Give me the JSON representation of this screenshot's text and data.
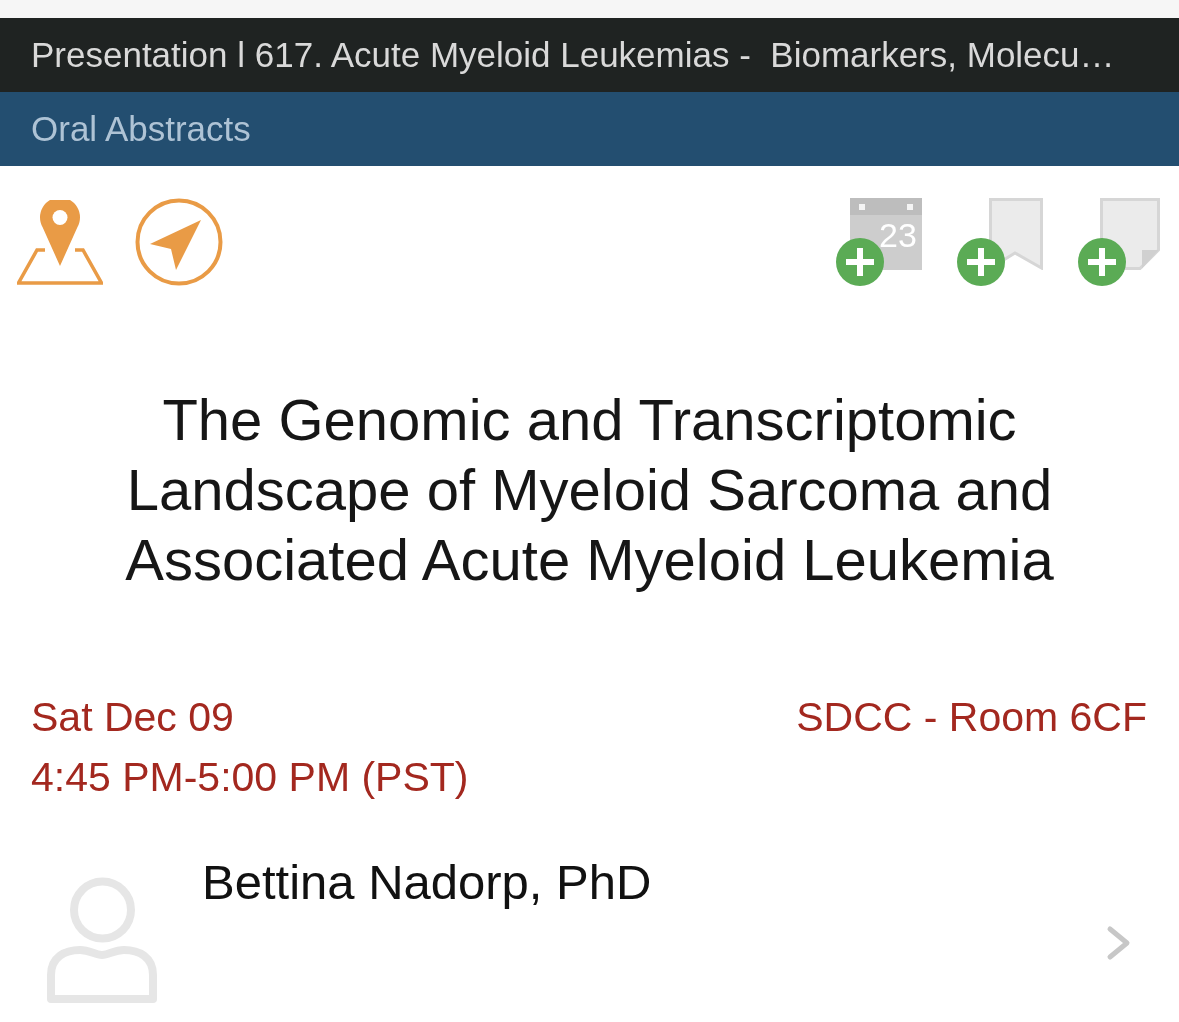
{
  "header": {
    "title": "Presentation l 617. Acute Myeloid Leukemias -  Biomarkers, Molecu…",
    "category": "Oral Abstracts"
  },
  "location_actions": [
    {
      "kind": "map"
    },
    {
      "kind": "navigate"
    }
  ],
  "add_actions": [
    {
      "kind": "calendar",
      "day": "23"
    },
    {
      "kind": "bookmark"
    },
    {
      "kind": "note"
    }
  ],
  "title": "The Genomic and Transcriptomic Landscape of Myeloid Sarcoma and Associated Acute Myeloid Leukemia",
  "schedule": {
    "date": "Sat Dec 09",
    "time": "4:45 PM-5:00 PM (PST)",
    "location": "SDCC - Room 6CF"
  },
  "speakers": [
    {
      "name": "Bettina Nadorp, PhD"
    }
  ]
}
